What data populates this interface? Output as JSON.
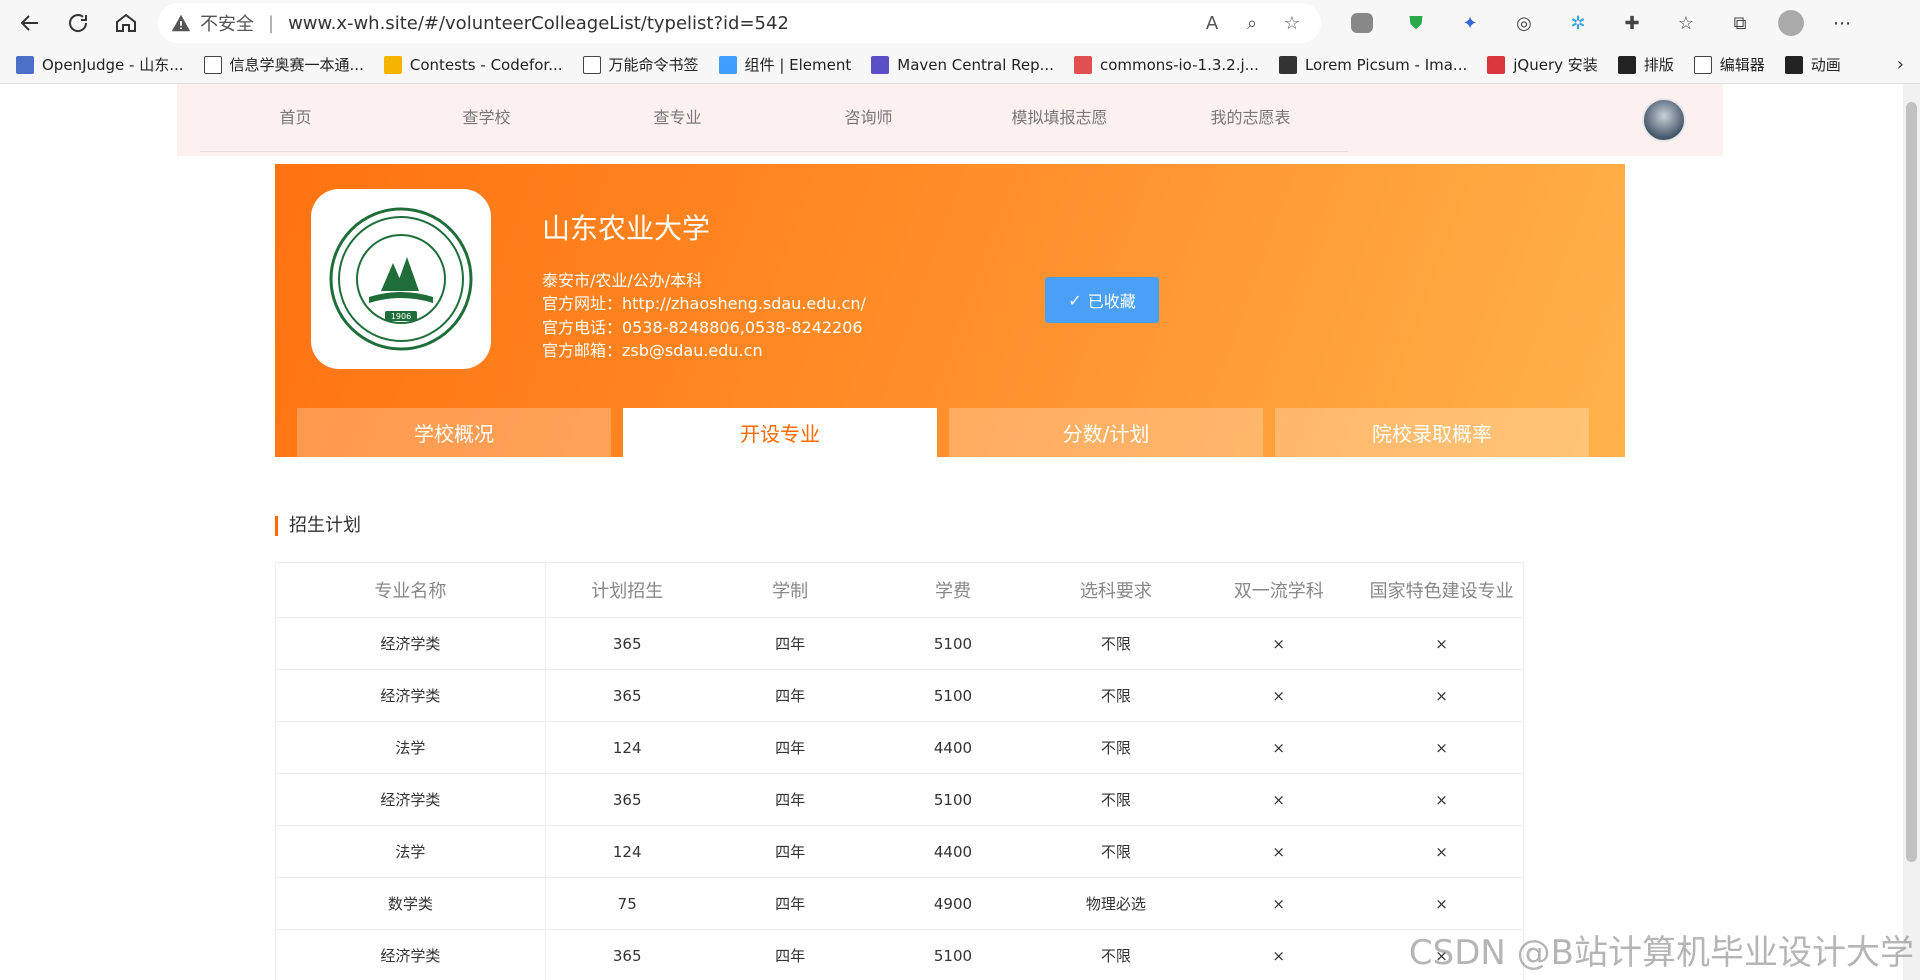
{
  "browser": {
    "insecure_label": "不安全",
    "url": "www.x-wh.site/#/volunteerColleageList/typelist?id=542",
    "bookmarks": [
      {
        "label": "OpenJudge - 山东...",
        "color": "#4a6fc4"
      },
      {
        "label": "信息学奥赛一本通...",
        "color": "#ffffff"
      },
      {
        "label": "Contests - Codefor...",
        "color": "#f5b400"
      },
      {
        "label": "万能命令书签",
        "color": "#ffffff"
      },
      {
        "label": "组件 | Element",
        "color": "#409eff"
      },
      {
        "label": "Maven Central Rep...",
        "color": "#5b50c8"
      },
      {
        "label": "commons-io-1.3.2.j...",
        "color": "#e05050"
      },
      {
        "label": "Lorem Picsum - Ima...",
        "color": "#333333"
      },
      {
        "label": "jQuery 安装",
        "color": "#d9363e"
      },
      {
        "label": "排版",
        "color": "#222222"
      },
      {
        "label": "编辑器",
        "color": "#ffffff"
      },
      {
        "label": "动画",
        "color": "#222222"
      }
    ]
  },
  "nav": {
    "items": [
      "首页",
      "查学校",
      "查专业",
      "咨询师",
      "模拟填报志愿",
      "我的志愿表"
    ]
  },
  "school": {
    "name": "山东农业大学",
    "tags": "泰安市/农业/公办/本科",
    "website": "官方网址：http://zhaosheng.sdau.edu.cn/",
    "phone": "官方电话：0538-8248806,0538-8242206",
    "email": "官方邮箱：zsb@sdau.edu.cn",
    "logo_year": "1906",
    "collect_label": "已收藏"
  },
  "tabs": [
    {
      "label": "学校概况",
      "active": false
    },
    {
      "label": "开设专业",
      "active": true
    },
    {
      "label": "分数/计划",
      "active": false
    },
    {
      "label": "院校录取概率",
      "active": false
    }
  ],
  "section_title": "招生计划",
  "table": {
    "headers": [
      "专业名称",
      "计划招生",
      "学制",
      "学费",
      "选科要求",
      "双一流学科",
      "国家特色建设专业"
    ],
    "rows": [
      [
        "经济学类",
        "365",
        "四年",
        "5100",
        "不限",
        "×",
        "×"
      ],
      [
        "经济学类",
        "365",
        "四年",
        "5100",
        "不限",
        "×",
        "×"
      ],
      [
        "法学",
        "124",
        "四年",
        "4400",
        "不限",
        "×",
        "×"
      ],
      [
        "经济学类",
        "365",
        "四年",
        "5100",
        "不限",
        "×",
        "×"
      ],
      [
        "法学",
        "124",
        "四年",
        "4400",
        "不限",
        "×",
        "×"
      ],
      [
        "数学类",
        "75",
        "四年",
        "4900",
        "物理必选",
        "×",
        "×"
      ],
      [
        "经济学类",
        "365",
        "四年",
        "5100",
        "不限",
        "×",
        "×"
      ]
    ]
  },
  "watermark": "CSDN @B站计算机毕业设计大学"
}
